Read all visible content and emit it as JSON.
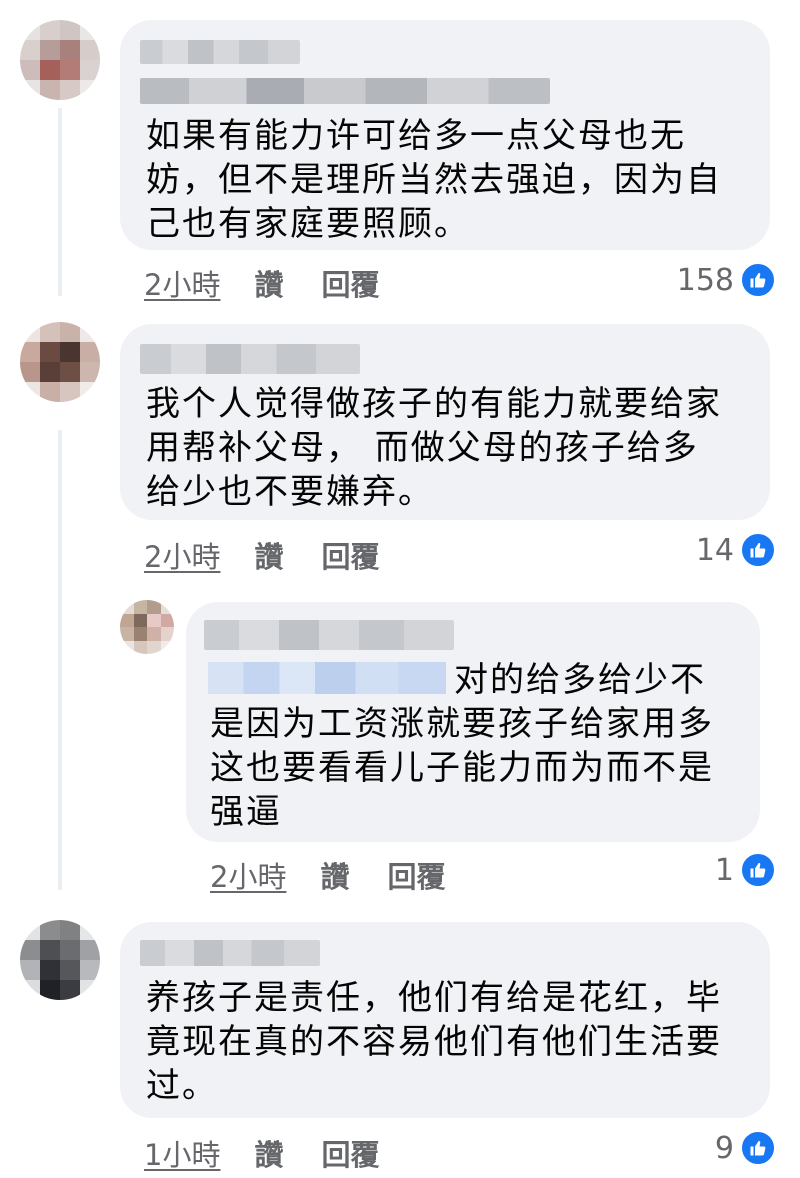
{
  "comments": [
    {
      "lines": [
        "如果有能力许可给多一点父母也无",
        "妨，但不是理所当然去强迫，因为自",
        "己也有家庭要照顾。"
      ],
      "time": "2小時",
      "like_label": "讚",
      "reply_label": "回覆",
      "reactions": "158"
    },
    {
      "lines": [
        "我个人觉得做孩子的有能力就要给家",
        "用帮补父母， 而做父母的孩子给多",
        "给少也不要嫌弃。"
      ],
      "time": "2小時",
      "like_label": "讚",
      "reply_label": "回覆",
      "reactions": "14"
    },
    {
      "lines": [
        "对的给多给少不",
        "是因为工资涨就要孩子给家用多",
        "这也要看看儿子能力而为而不是",
        "强逼"
      ],
      "time": "2小時",
      "like_label": "讚",
      "reply_label": "回覆",
      "reactions": "1"
    },
    {
      "lines": [
        "养孩子是责任，他们有给是花红，毕",
        "竟现在真的不容易他们有他们生活要",
        "过。"
      ],
      "time": "1小時",
      "like_label": "讚",
      "reply_label": "回覆",
      "reactions": "9"
    }
  ],
  "colors": {
    "bubble": "#f0f2f5",
    "meta_text": "#65676b",
    "like_blue": "#1877f2"
  },
  "icons": {
    "reaction": "thumbs-up-icon"
  }
}
